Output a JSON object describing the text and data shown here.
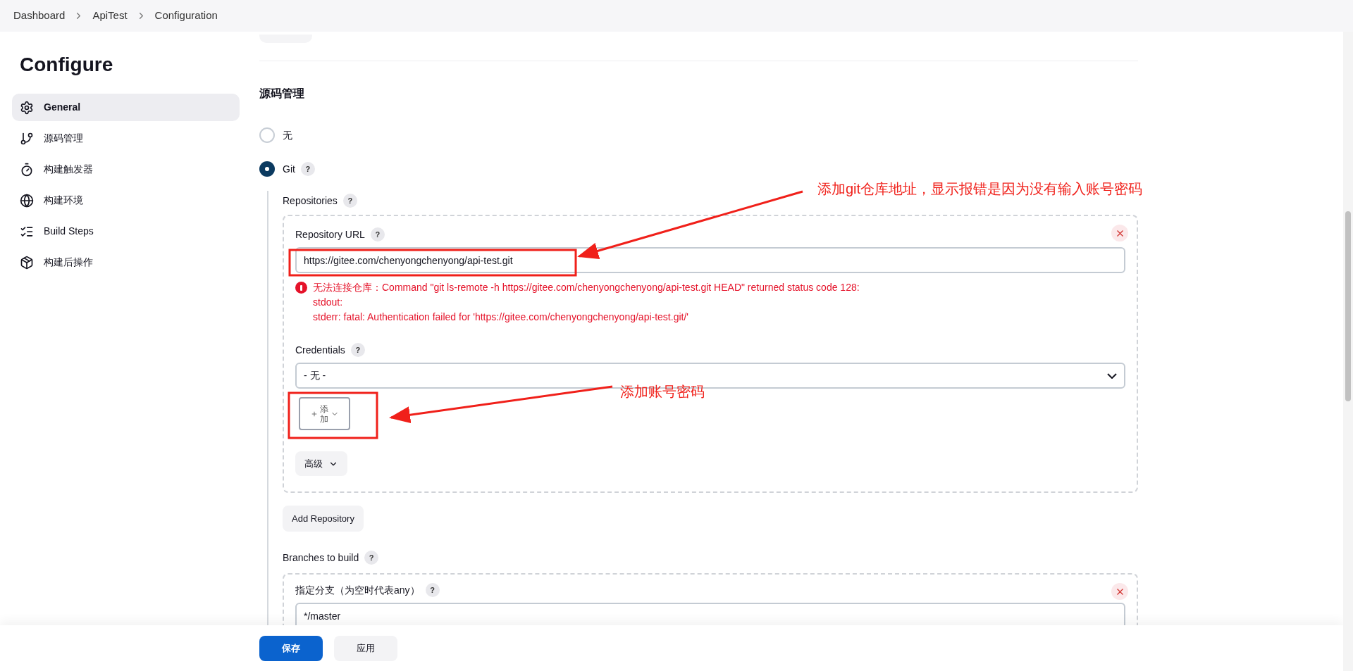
{
  "breadcrumb": [
    "Dashboard",
    "ApiTest",
    "Configuration"
  ],
  "sidebar": {
    "title": "Configure",
    "items": [
      {
        "label": "General",
        "selected": true
      },
      {
        "label": "源码管理",
        "selected": false
      },
      {
        "label": "构建触发器",
        "selected": false
      },
      {
        "label": "构建环境",
        "selected": false
      },
      {
        "label": "Build Steps",
        "selected": false
      },
      {
        "label": "构建后操作",
        "selected": false
      }
    ]
  },
  "section": {
    "title": "源码管理",
    "options": [
      {
        "label": "无",
        "selected": false
      },
      {
        "label": "Git",
        "selected": true,
        "help": "?"
      }
    ]
  },
  "repositories": {
    "label": "Repositories",
    "help": "?",
    "url_label": "Repository URL",
    "url_help": "?",
    "url_value": "https://gitee.com/chenyongchenyong/api-test.git",
    "error_lines": [
      "无法连接仓库：Command \"git ls-remote -h https://gitee.com/chenyongchenyong/api-test.git HEAD\" returned status code 128:",
      "stdout:",
      "stderr: fatal: Authentication failed for 'https://gitee.com/chenyongchenyong/api-test.git/'"
    ],
    "credentials_label": "Credentials",
    "credentials_help": "?",
    "credentials_value": "- 无 -",
    "add_button": "添加",
    "advanced_button": "高级",
    "add_repository": "Add Repository"
  },
  "branches": {
    "label": "Branches to build",
    "help": "?",
    "spec_label": "指定分支（为空时代表any）",
    "spec_help": "?",
    "spec_value": "*/master"
  },
  "footer": {
    "save": "保存",
    "apply": "应用"
  },
  "annotations": [
    "添加git仓库地址，显示报错是因为没有输入账号密码",
    "添加账号密码"
  ]
}
